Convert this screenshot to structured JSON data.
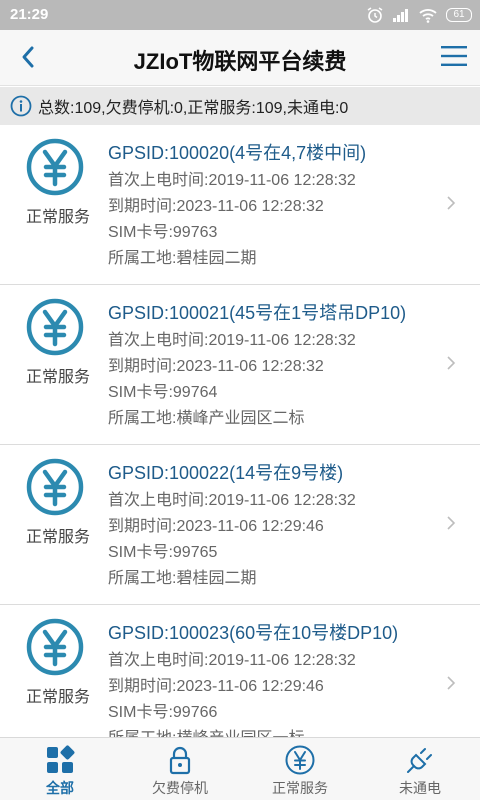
{
  "statusbar": {
    "time": "21:29",
    "battery": "61"
  },
  "header": {
    "title": "JZIoT物联网平台续费"
  },
  "summary": {
    "text": "总数:109,欠费停机:0,正常服务:109,未通电:0"
  },
  "devices": [
    {
      "gpsid": "GPSID:100020(4号在4,7楼中间)",
      "status": "正常服务",
      "first_power": "首次上电时间:2019-11-06 12:28:32",
      "expire": "到期时间:2023-11-06 12:28:32",
      "sim": "SIM卡号:99763",
      "site": "所属工地:碧桂园二期"
    },
    {
      "gpsid": "GPSID:100021(45号在1号塔吊DP10)",
      "status": "正常服务",
      "first_power": "首次上电时间:2019-11-06 12:28:32",
      "expire": "到期时间:2023-11-06 12:28:32",
      "sim": "SIM卡号:99764",
      "site": "所属工地:横峰产业园区二标"
    },
    {
      "gpsid": "GPSID:100022(14号在9号楼)",
      "status": "正常服务",
      "first_power": "首次上电时间:2019-11-06 12:28:32",
      "expire": "到期时间:2023-11-06 12:29:46",
      "sim": "SIM卡号:99765",
      "site": "所属工地:碧桂园二期"
    },
    {
      "gpsid": "GPSID:100023(60号在10号楼DP10)",
      "status": "正常服务",
      "first_power": "首次上电时间:2019-11-06 12:28:32",
      "expire": "到期时间:2023-11-06 12:29:46",
      "sim": "SIM卡号:99766",
      "site": "所属工地:横峰产业园区一标"
    }
  ],
  "tabs": [
    {
      "label": "全部",
      "icon": "grid-icon",
      "active": true
    },
    {
      "label": "欠费停机",
      "icon": "lock-icon",
      "active": false
    },
    {
      "label": "正常服务",
      "icon": "yen-icon",
      "active": false
    },
    {
      "label": "未通电",
      "icon": "plug-icon",
      "active": false
    }
  ],
  "colors": {
    "accent": "#1e6fa8",
    "icon_teal": "#2c8ab0",
    "title_blue": "#1e5b8a"
  }
}
